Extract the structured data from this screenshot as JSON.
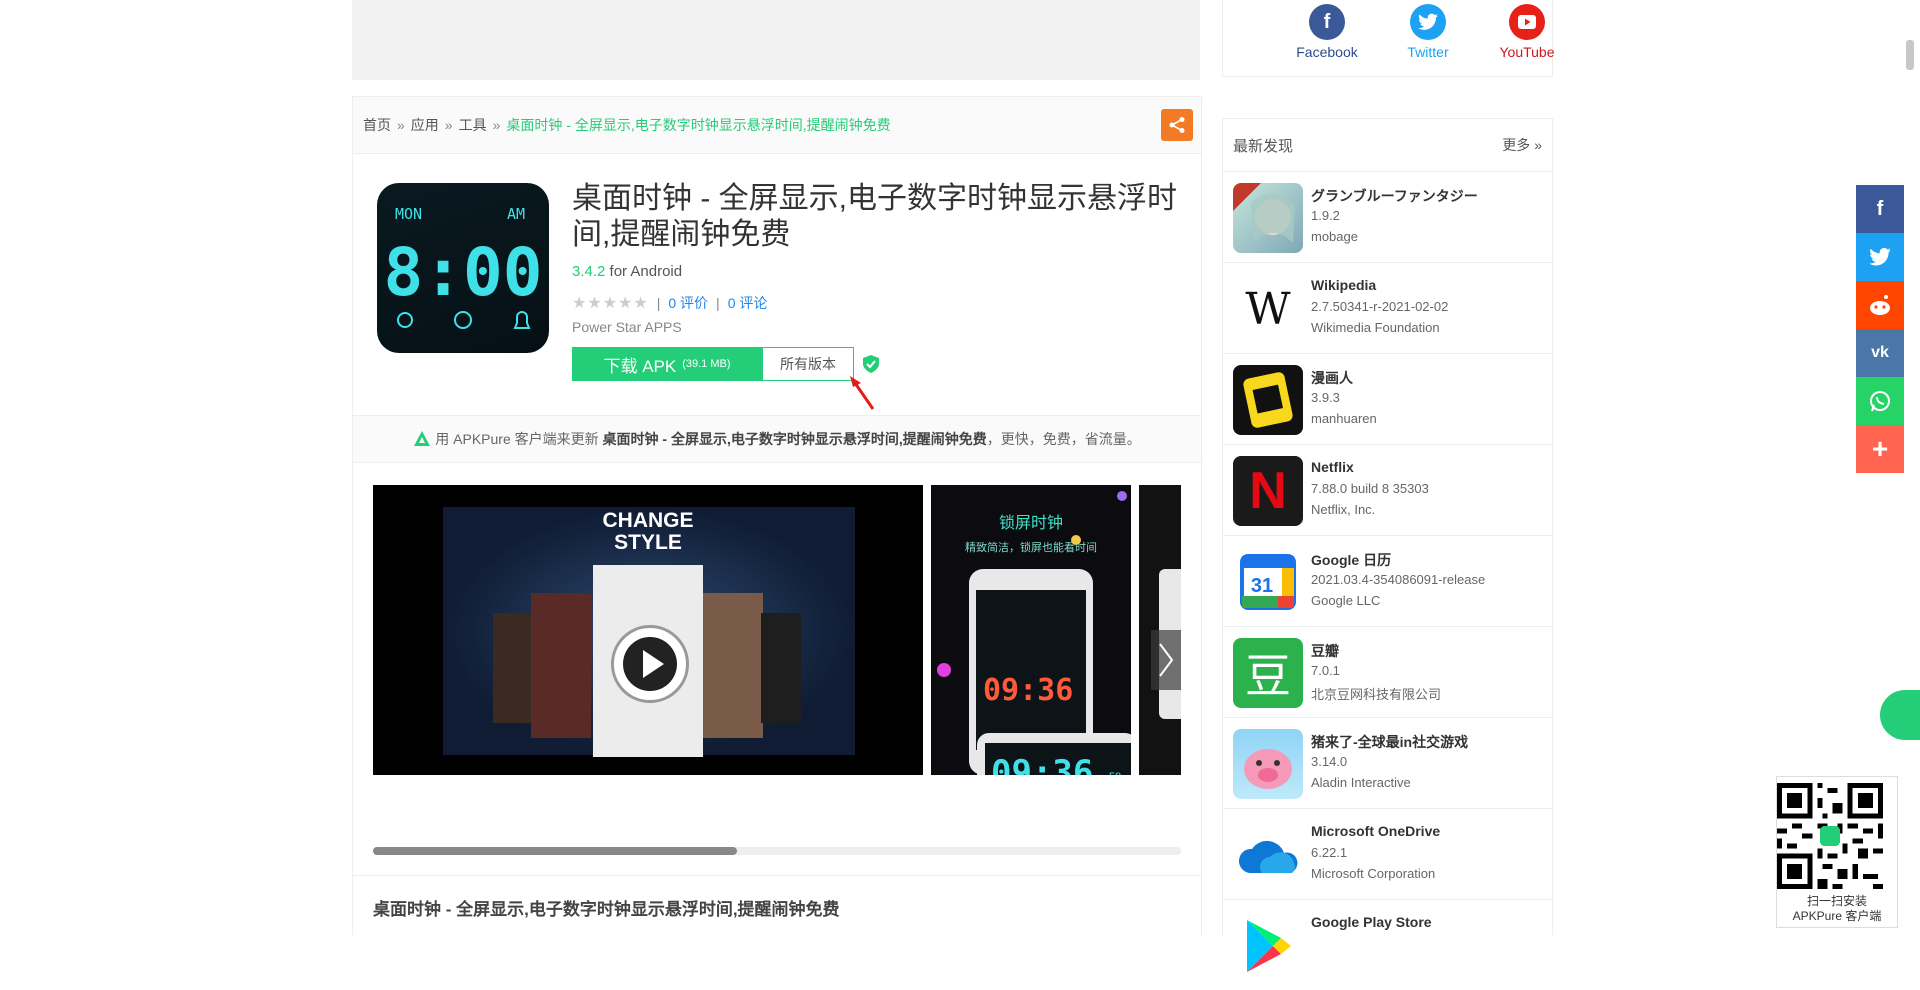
{
  "social": {
    "facebook": "Facebook",
    "twitter": "Twitter",
    "youtube": "YouTube"
  },
  "breadcrumb": {
    "home": "首页",
    "apps": "应用",
    "tools": "工具",
    "current": "桌面时钟 - 全屏显示,电子数字时钟显示悬浮时间,提醒闹钟免费",
    "separator": "»"
  },
  "app": {
    "title": "桌面时钟 - 全屏显示,电子数字时钟显示悬浮时间,提醒闹钟免费",
    "version": "3.4.2",
    "platform": "for Android",
    "ratings_count": "0 评价",
    "reviews_count": "0 评论",
    "developer": "Power Star APPS",
    "download_label": "下载 APK",
    "download_size": "(39.1 MB)",
    "versions_label": "所有版本",
    "icon_text": {
      "day": "MON",
      "ampm": "AM",
      "time": "8:00"
    }
  },
  "promo": {
    "prefix": "用 APKPure 客户端来更新",
    "app_name": "桌面时钟 - 全屏显示,电子数字时钟显示悬浮时间,提醒闹钟免费",
    "suffix": "，更快，免费，省流量。"
  },
  "screenshots": {
    "shot1_title_line1": "CHANGE",
    "shot1_title_line2": "STYLE",
    "shot2_title": "锁屏时钟",
    "shot2_subtitle": "精致简洁，锁屏也能看时间",
    "shot2_time": "09:36",
    "shot2_seconds": "59"
  },
  "description": {
    "title": "桌面时钟 - 全屏显示,电子数字时钟显示悬浮时间,提醒闹钟免费"
  },
  "sidebar": {
    "heading": "最新发现",
    "more": "更多 »",
    "items": [
      {
        "name": "グランブルーファンタジー",
        "version": "1.9.2",
        "developer": "mobage"
      },
      {
        "name": "Wikipedia",
        "version": "2.7.50341-r-2021-02-02",
        "developer": "Wikimedia Foundation"
      },
      {
        "name": "漫画人",
        "version": "3.9.3",
        "developer": "manhuaren"
      },
      {
        "name": "Netflix",
        "version": "7.88.0 build 8 35303",
        "developer": "Netflix, Inc."
      },
      {
        "name": "Google 日历",
        "version": "2021.03.4-354086091-release",
        "developer": "Google LLC"
      },
      {
        "name": "豆瓣",
        "version": "7.0.1",
        "developer": "北京豆网科技有限公司"
      },
      {
        "name": "猪来了-全球最in社交游戏",
        "version": "3.14.0",
        "developer": "Aladin Interactive"
      },
      {
        "name": "Microsoft OneDrive",
        "version": "6.22.1",
        "developer": "Microsoft Corporation"
      },
      {
        "name": "Google Play Store",
        "version": "",
        "developer": ""
      }
    ]
  },
  "qr": {
    "line1": "扫一扫安装",
    "line2": "APKPure 客户端"
  },
  "colors": {
    "accent": "#24cd77",
    "link": "#1e88e5",
    "share_orange": "#f47b26"
  }
}
